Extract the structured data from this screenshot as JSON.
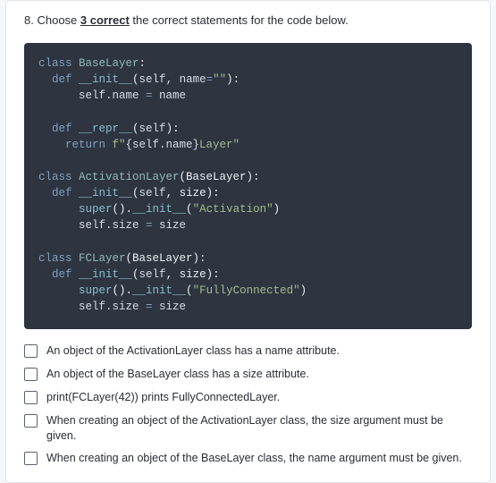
{
  "question": {
    "number": "8.",
    "prefix": "Choose ",
    "bold": "3 correct",
    "suffix": "  the correct statements for the code below."
  },
  "code": {
    "l1a": "class",
    "l1b": " BaseLayer",
    "l1c": ":",
    "l2a": "  def",
    "l2b": " __init__",
    "l2c": "(",
    "l2d": "self",
    "l2e": ", name",
    "l2f": "=",
    "l2g": "\"\"",
    "l2h": "):",
    "l3a": "      self.name ",
    "l3b": "=",
    "l3c": " name",
    "l4a": "  def",
    "l4b": " __repr__",
    "l4c": "(",
    "l4d": "self",
    "l4e": "):",
    "l5a": "    return",
    "l5b": " f\"",
    "l5c": "{self.name}",
    "l5d": "Layer\"",
    "l6a": "class",
    "l6b": " ActivationLayer",
    "l6c": "(BaseLayer):",
    "l7a": "  def",
    "l7b": " __init__",
    "l7c": "(",
    "l7d": "self",
    "l7e": ", size):",
    "l8a": "      super",
    "l8b": "().",
    "l8c": "__init__",
    "l8d": "(",
    "l8e": "\"Activation\"",
    "l8f": ")",
    "l9a": "      self.size ",
    "l9b": "=",
    "l9c": " size",
    "l10a": "class",
    "l10b": " FCLayer",
    "l10c": "(BaseLayer):",
    "l11a": "  def",
    "l11b": " __init__",
    "l11c": "(",
    "l11d": "self",
    "l11e": ", size):",
    "l12a": "      super",
    "l12b": "().",
    "l12c": "__init__",
    "l12d": "(",
    "l12e": "\"FullyConnected\"",
    "l12f": ")",
    "l13a": "      self.size ",
    "l13b": "=",
    "l13c": " size"
  },
  "options": [
    "An object of the ActivationLayer class has a name attribute.",
    "An object of the BaseLayer class has a size attribute.",
    "print(FCLayer(42)) prints FullyConnectedLayer.",
    "When creating an object of the ActivationLayer class, the size argument must be given.",
    "When creating an object of the BaseLayer class, the name argument must be given."
  ]
}
